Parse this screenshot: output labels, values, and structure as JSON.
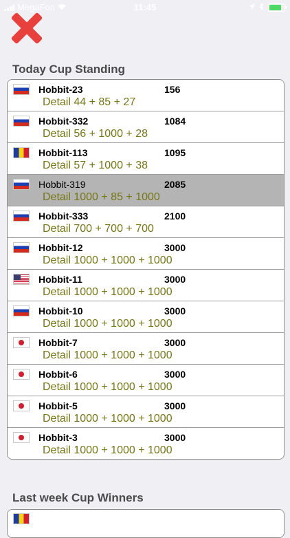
{
  "status_bar": {
    "carrier": "MegaFon",
    "time": "11:45"
  },
  "today_section": {
    "title": "Today Cup Standing",
    "rows": [
      {
        "flag": "russia-flag",
        "name": "Hobbit-23",
        "score": "156",
        "detail": "Detail 44 + 85 + 27",
        "selected": false
      },
      {
        "flag": "russia-flag",
        "name": "Hobbit-332",
        "score": "1084",
        "detail": "Detail 56 + 1000 + 28",
        "selected": false
      },
      {
        "flag": "romania-flag",
        "name": "Hobbit-113",
        "score": "1095",
        "detail": "Detail 57 + 1000 + 38",
        "selected": false
      },
      {
        "flag": "russia-flag",
        "name": "Hobbit-319",
        "score": "2085",
        "detail": "Detail 1000 + 85 + 1000",
        "selected": true
      },
      {
        "flag": "russia-flag",
        "name": "Hobbit-333",
        "score": "2100",
        "detail": "Detail 700 + 700 + 700",
        "selected": false
      },
      {
        "flag": "russia-flag",
        "name": "Hobbit-12",
        "score": "3000",
        "detail": "Detail 1000 + 1000 + 1000",
        "selected": false
      },
      {
        "flag": "usa-flag",
        "name": "Hobbit-11",
        "score": "3000",
        "detail": "Detail 1000 + 1000 + 1000",
        "selected": false
      },
      {
        "flag": "russia-flag",
        "name": "Hobbit-10",
        "score": "3000",
        "detail": "Detail 1000 + 1000 + 1000",
        "selected": false
      },
      {
        "flag": "japan-flag",
        "name": "Hobbit-7",
        "score": "3000",
        "detail": "Detail 1000 + 1000 + 1000",
        "selected": false
      },
      {
        "flag": "japan-flag",
        "name": "Hobbit-6",
        "score": "3000",
        "detail": "Detail 1000 + 1000 + 1000",
        "selected": false
      },
      {
        "flag": "japan-flag",
        "name": "Hobbit-5",
        "score": "3000",
        "detail": "Detail 1000 + 1000 + 1000",
        "selected": false
      },
      {
        "flag": "japan-flag",
        "name": "Hobbit-3",
        "score": "3000",
        "detail": "Detail 1000 + 1000 + 1000",
        "selected": false
      }
    ]
  },
  "last_week_section": {
    "title": "Last week Cup Winners"
  },
  "colors": {
    "close": "#e8403c",
    "detail_text": "#767615",
    "selected_row": "#b4b4b4",
    "background": "#efeff4"
  }
}
